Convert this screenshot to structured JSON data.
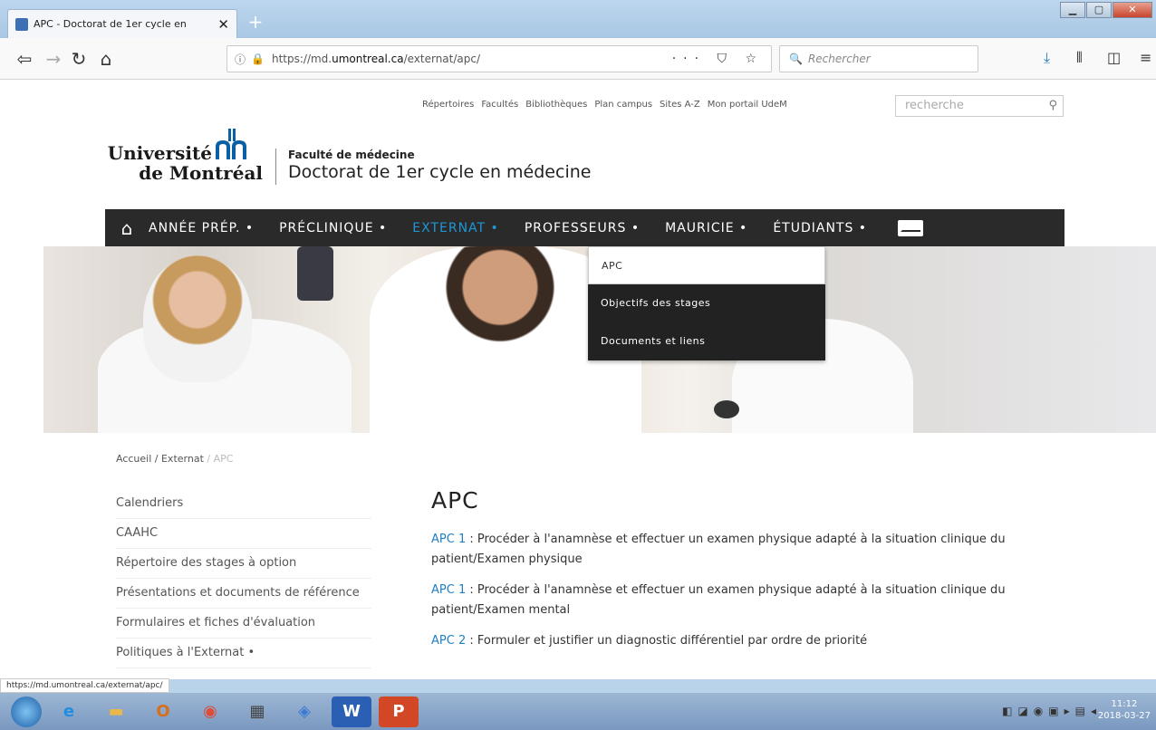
{
  "browser": {
    "tab_title": "APC - Doctorat de 1er cycle en",
    "tab_close": "✕",
    "new_tab": "+",
    "url_prefix": "https://md.",
    "url_host": "umontreal.ca",
    "url_path": "/externat/apc/",
    "url_tools": "··· ⛉ ☆",
    "search_placeholder": "Rechercher"
  },
  "page": {
    "top_links": [
      "Répertoires",
      "Facultés",
      "Bibliothèques",
      "Plan campus",
      "Sites A-Z",
      "Mon portail UdeM"
    ],
    "search_placeholder": "recherche",
    "logo_line1": "Université",
    "logo_line2": "de Montréal",
    "faculty": "Faculté de médecine",
    "program": "Doctorat de 1er cycle en médecine",
    "nav": [
      {
        "label": "ANNÉE PRÉP. •"
      },
      {
        "label": "PRÉCLINIQUE •"
      },
      {
        "label": "EXTERNAT •"
      },
      {
        "label": "PROFESSEURS •"
      },
      {
        "label": "MAURICIE •"
      },
      {
        "label": "ÉTUDIANTS •"
      }
    ],
    "dropdown": [
      "APC",
      "Objectifs des stages",
      "Documents et liens"
    ],
    "breadcrumb": {
      "home": "Accueil",
      "sep": " / ",
      "section": "Externat",
      "current": "APC"
    },
    "sidebar": [
      "Calendriers",
      "CAAHC",
      "Répertoire des stages à option",
      "Présentations et documents de référence",
      "Formulaires et fiches d'évaluation",
      "Politiques à l'Externat •"
    ],
    "heading": "APC",
    "items": [
      {
        "link": "APC 1",
        "text": " : Procéder à l'anamnèse et effectuer un examen physique adapté à la situation clinique du patient/Examen physique"
      },
      {
        "link": "APC 1",
        "text": " : Procéder à l'anamnèse et effectuer un examen physique adapté à la situation clinique du patient/Examen mental"
      },
      {
        "link": "APC 2",
        "text": " : Formuler et justifier un diagnostic différentiel par ordre de priorité"
      }
    ]
  },
  "status_url": "https://md.umontreal.ca/externat/apc/",
  "clock": {
    "time": "11:12",
    "date": "2018-03-27"
  }
}
